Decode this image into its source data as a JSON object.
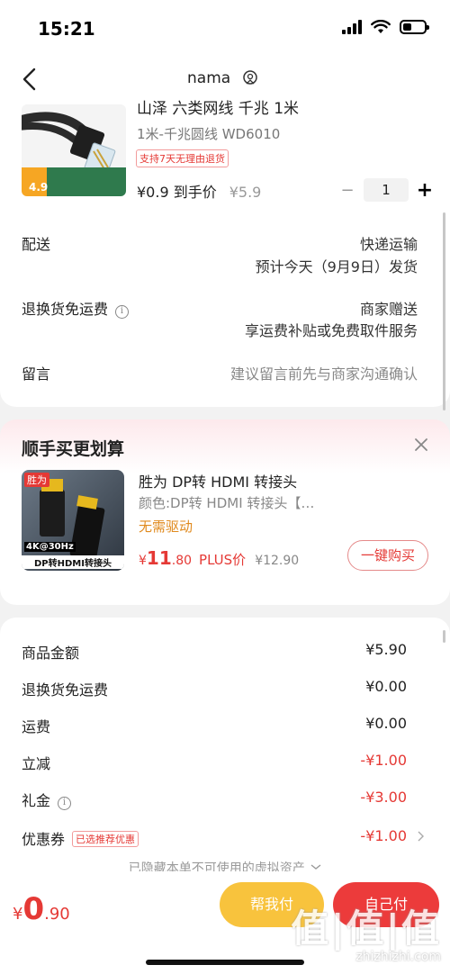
{
  "status_bar": {
    "time": "15:21"
  },
  "nav": {
    "title": "nama"
  },
  "product": {
    "title": "山泽 六类网线 千兆 1米",
    "spec": "1米-千兆圆线 WD6010",
    "badge_price": "4.9",
    "tag": "支持7天无理由退货",
    "price": "¥0.9 到手价",
    "original_price": "¥5.9",
    "quantity": "1"
  },
  "delivery": {
    "label": "配送",
    "method": "快递运输",
    "estimate": "预计今天（9月9日）发货"
  },
  "return_shipping": {
    "label": "退换货免运费",
    "value": "商家赠送",
    "detail": "享运费补贴或免费取件服务"
  },
  "message": {
    "label": "留言",
    "placeholder": "建议留言前先与商家沟通确认"
  },
  "recommend": {
    "heading": "顺手买更划算",
    "img_brand": "胜为",
    "img_spec": "4K@30Hz",
    "img_caption": "DP转HDMI转接头",
    "title": "胜为 DP转 HDMI 转接头",
    "color": "颜色:DP转 HDMI 转接头【…",
    "note": "无需驱动",
    "price_symbol": "¥",
    "price_int": "11",
    "price_dec": ".80",
    "plus_label": "PLUS价",
    "original_price": "¥12.90",
    "buy_label": "一键购买"
  },
  "summary": {
    "rows": [
      {
        "label": "商品金额",
        "value": "¥5.90"
      },
      {
        "label": "退换货免运费",
        "value": "¥0.00"
      },
      {
        "label": "运费",
        "value": "¥0.00"
      },
      {
        "label": "立减",
        "value": "-¥1.00"
      },
      {
        "label": "礼金",
        "value": "-¥3.00"
      },
      {
        "label": "优惠券",
        "value": "-¥1.00",
        "tag": "已选推荐优惠"
      }
    ],
    "hidden_note": "已隐藏本单不可使用的虚拟资产"
  },
  "bottom": {
    "total_symbol": "¥",
    "total_int": "0",
    "total_dec": ".90",
    "help_pay": "帮我付",
    "self_pay": "自己付"
  },
  "watermark": {
    "big": "值|值|值",
    "small": "zhizhizhi.com"
  },
  "colors": {
    "accent_red": "#e53935",
    "help_yellow": "#f8c33d",
    "pay_red": "#ec3b3b"
  }
}
